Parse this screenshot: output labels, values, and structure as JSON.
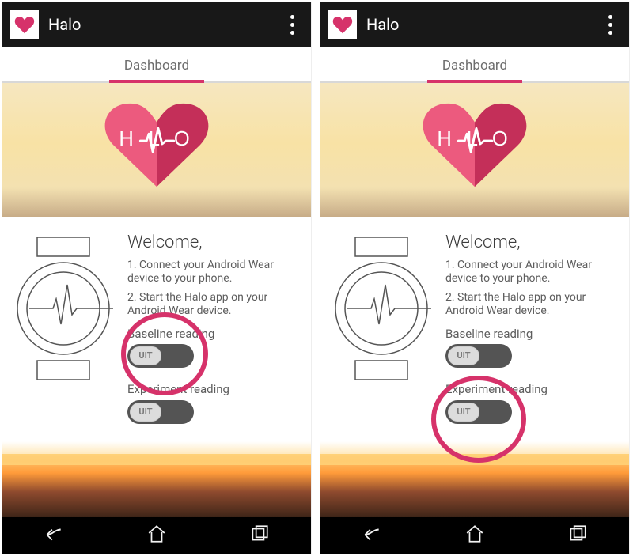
{
  "app": {
    "title": "Halo",
    "logo_text": "HALO",
    "overflow_name": "overflow-menu"
  },
  "tab": {
    "label": "Dashboard"
  },
  "welcome": {
    "title": "Welcome,",
    "step1": "1. Connect your Android Wear device to your phone.",
    "step2": "2. Start the Halo app on your Android Wear device."
  },
  "toggles": {
    "baseline": {
      "label": "Baseline reading",
      "state_text": "UIT",
      "on": false
    },
    "experiment": {
      "label": "Experiment reading",
      "state_text": "UIT",
      "on": false
    }
  },
  "colors": {
    "accent": "#d6326a",
    "actionbar": "#181818",
    "switch_track": "#545454"
  },
  "nav": {
    "back": "back",
    "home": "home",
    "recents": "recents"
  },
  "screenshots": [
    {
      "highlight": "baseline"
    },
    {
      "highlight": "experiment"
    }
  ]
}
